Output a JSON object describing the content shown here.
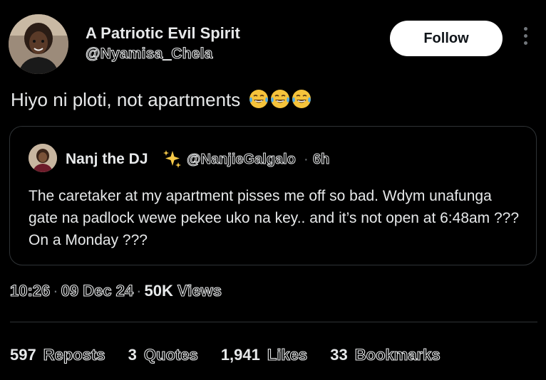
{
  "author": {
    "display_name": "A Patriotic Evil Spirit",
    "handle": "@Nyamisa_Chela",
    "follow_label": "Follow"
  },
  "tweet": {
    "text": "Hiyo ni ploti,  not apartments",
    "emoji_icon": "face-with-tears-of-joy-icon",
    "emoji_count": 3
  },
  "quote": {
    "display_name": "Nanj the DJ",
    "name_icon": "sparkles-icon",
    "handle": "@NanjieGalgalo",
    "separator": "·",
    "time": "6h",
    "text": "The caretaker at my apartment pisses me off so bad. Wdym unafunga gate na padlock wewe pekee uko na key.. and it’s not open at 6:48am ??? On a Monday ???"
  },
  "meta": {
    "time": "10:26",
    "date": "09 Dec 24",
    "views_count": "50K",
    "views_label": "Views",
    "separator": "·"
  },
  "stats": {
    "reposts_count": "597",
    "reposts_label": "Reposts",
    "quotes_count": "3",
    "quotes_label": "Quotes",
    "likes_count": "1,941",
    "likes_label": "Likes",
    "bookmarks_count": "33",
    "bookmarks_label": "Bookmarks"
  },
  "colors": {
    "background": "#000000",
    "text": "#e7e9ea",
    "secondary": "#71767b",
    "border": "#2f3336",
    "follow_bg": "#ffffff",
    "emoji_yellow": "#f5c33b"
  }
}
